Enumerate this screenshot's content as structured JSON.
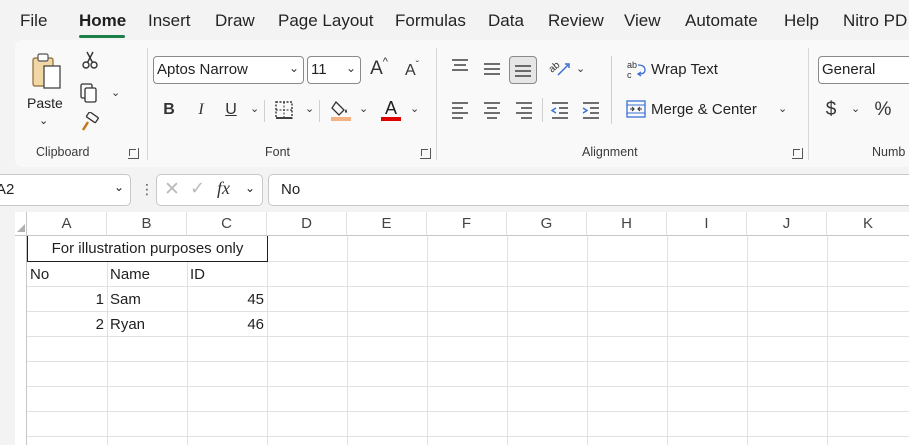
{
  "menu": {
    "tabs": [
      "File",
      "Home",
      "Insert",
      "Draw",
      "Page Layout",
      "Formulas",
      "Data",
      "Review",
      "View",
      "Automate",
      "Help",
      "Nitro PD"
    ],
    "active": "Home"
  },
  "ribbon": {
    "clipboard": {
      "paste_label": "Paste",
      "group_label": "Clipboard"
    },
    "font": {
      "font_name": "Aptos Narrow",
      "font_size": "11",
      "bold": "B",
      "italic": "I",
      "underline": "U",
      "grow": "A",
      "shrink": "A",
      "fill_color": "#f4b183",
      "font_color_glyph": "A",
      "font_color": "#e00000",
      "group_label": "Font"
    },
    "alignment": {
      "wrap_text": "Wrap Text",
      "merge_center": "Merge & Center",
      "group_label": "Alignment"
    },
    "number": {
      "format": "General",
      "currency": "$",
      "percent": "%",
      "group_label": "Numb"
    }
  },
  "formula_bar": {
    "name_box": "A2",
    "fx": "fx",
    "content": "No"
  },
  "sheet": {
    "columns": [
      "A",
      "B",
      "C",
      "D",
      "E",
      "F",
      "G",
      "H",
      "I",
      "J",
      "K"
    ],
    "merged_title": "For illustration purposes only",
    "header_row": [
      "No",
      "Name",
      "ID"
    ],
    "rows": [
      [
        "1",
        "Sam",
        "45"
      ],
      [
        "2",
        "Ryan",
        "46"
      ]
    ]
  },
  "colors": {
    "accent_green": "#1a7f48",
    "selection_green": "#107c41"
  }
}
